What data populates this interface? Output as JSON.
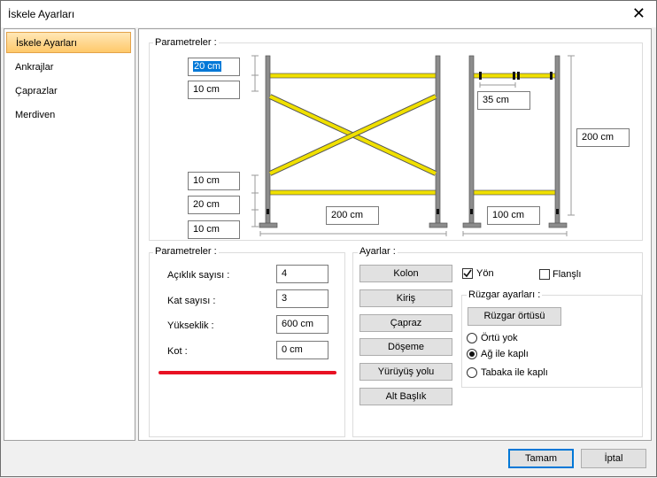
{
  "window": {
    "title": "İskele Ayarları",
    "close_glyph": "✕"
  },
  "sidebar": {
    "items": [
      {
        "label": "İskele Ayarları",
        "active": true
      },
      {
        "label": "Ankrajlar"
      },
      {
        "label": "Çaprazlar"
      },
      {
        "label": "Merdiven"
      }
    ]
  },
  "diagram": {
    "group_label": "Parametreler :",
    "top_height": "20 cm",
    "mid_height": "10 cm",
    "low_gap_1": "10 cm",
    "low_gap_2": "20 cm",
    "base_gap": "10 cm",
    "front_width": "200 cm",
    "side_gap": "35 cm",
    "total_height": "200 cm",
    "side_width": "100 cm"
  },
  "params": {
    "group_label": "Parametreler :",
    "rows": [
      {
        "label": "Açıklık sayısı :",
        "value": "4"
      },
      {
        "label": "Kat sayısı :",
        "value": "3"
      },
      {
        "label": "Yükseklik :",
        "value": "600 cm"
      },
      {
        "label": "Kot :",
        "value": "0 cm"
      }
    ]
  },
  "settings": {
    "group_label": "Ayarlar :",
    "buttons": [
      "Kolon",
      "Kiriş",
      "Çapraz",
      "Döşeme",
      "Yürüyüş yolu",
      "Alt Başlık"
    ],
    "yon_label": "Yön",
    "yon_checked": true,
    "flansli_label": "Flanşlı",
    "flansli_checked": false,
    "wind": {
      "group_label": "Rüzgar ayarları :",
      "button": "Rüzgar örtüsü",
      "options": [
        "Örtü yok",
        "Ağ ile kaplı",
        "Tabaka ile kaplı"
      ],
      "selected": 1
    }
  },
  "footer": {
    "ok": "Tamam",
    "cancel": "İptal"
  },
  "colors": {
    "accent": "#0078d7",
    "beam": "#f0e000",
    "highlight_line": "#e81123"
  }
}
